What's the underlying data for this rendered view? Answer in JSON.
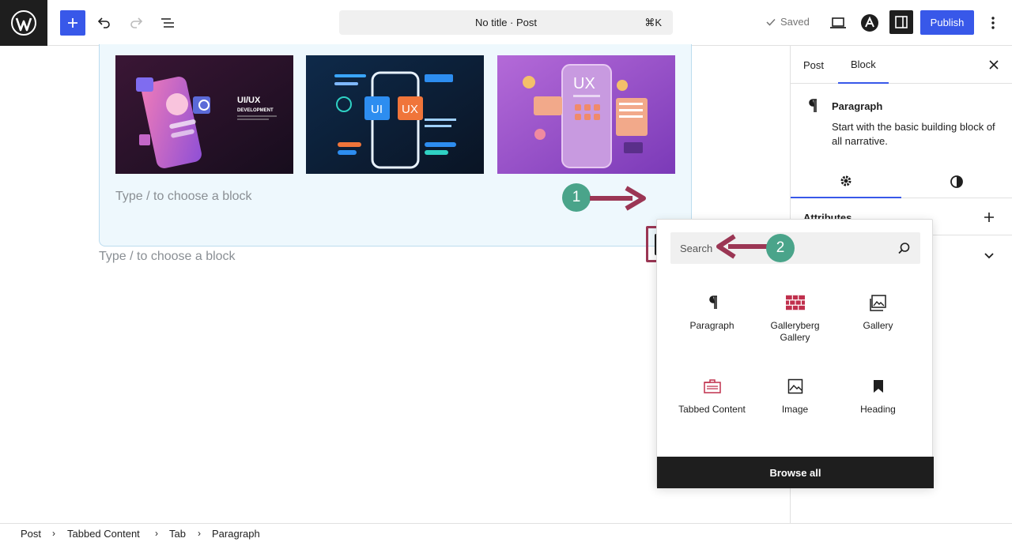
{
  "header": {
    "doc_title": "No title · Post",
    "shortcut": "⌘K",
    "saved_label": "Saved",
    "publish_label": "Publish"
  },
  "editor": {
    "tab_placeholder": "Type / to choose a block",
    "main_placeholder": "Type / to choose a block",
    "thumb1_title": "UI/UX",
    "thumb1_subtitle": "DEVELOPMENT",
    "thumb2_left": "UI",
    "thumb2_right": "UX",
    "thumb3_title": "UX"
  },
  "annotations": {
    "step1": "1",
    "step2": "2",
    "arrow_color": "#9b3654",
    "badge_color": "#4aa48a"
  },
  "sidebar": {
    "tabs": [
      {
        "label": "Post"
      },
      {
        "label": "Block"
      }
    ],
    "block_name": "Paragraph",
    "block_desc": "Start with the basic building block of all narrative.",
    "attributes_label": "Attributes"
  },
  "inserter": {
    "search_placeholder": "Search",
    "blocks": [
      {
        "label": "Paragraph",
        "icon": "paragraph-icon"
      },
      {
        "label": "Galleryberg Gallery",
        "icon": "galleryberg-icon"
      },
      {
        "label": "Gallery",
        "icon": "gallery-icon"
      },
      {
        "label": "Tabbed Content",
        "icon": "tabbed-content-icon"
      },
      {
        "label": "Image",
        "icon": "image-icon"
      },
      {
        "label": "Heading",
        "icon": "bookmark-icon"
      }
    ],
    "browse_all": "Browse all"
  },
  "breadcrumbs": [
    "Post",
    "Tabbed Content",
    "Tab",
    "Paragraph"
  ],
  "colors": {
    "accent": "#3858e9",
    "dark": "#1e1e1e"
  }
}
